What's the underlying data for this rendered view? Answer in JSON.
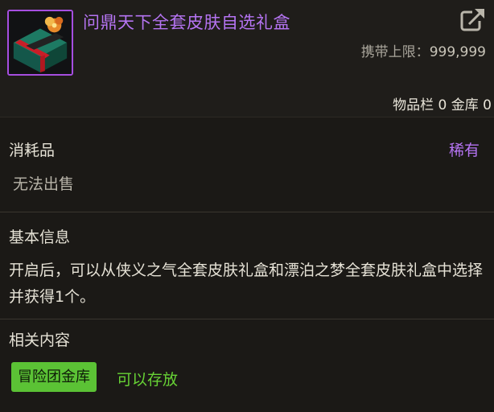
{
  "item": {
    "title": "问鼎天下全套皮肤自选礼盒",
    "carry_limit_label": "携带上限：",
    "carry_limit_value": "999,999",
    "storage": "物品栏 0 金库 0"
  },
  "type": {
    "label": "消耗品",
    "rarity": "稀有",
    "sell_status": "无法出售"
  },
  "basic_info": {
    "title": "基本信息",
    "description": "开启后，可以从侠义之气全套皮肤礼盒和漂泊之梦全套皮肤礼盒中选择并获得1个。"
  },
  "related": {
    "title": "相关内容",
    "badge": "冒险团金库",
    "status": "可以存放"
  },
  "colors": {
    "rarity_purple": "#b574f2",
    "badge_green": "#5bc235",
    "status_green": "#67d235"
  },
  "icons": {
    "item_icon": "gift-box-icon",
    "share_icon": "share-icon"
  }
}
